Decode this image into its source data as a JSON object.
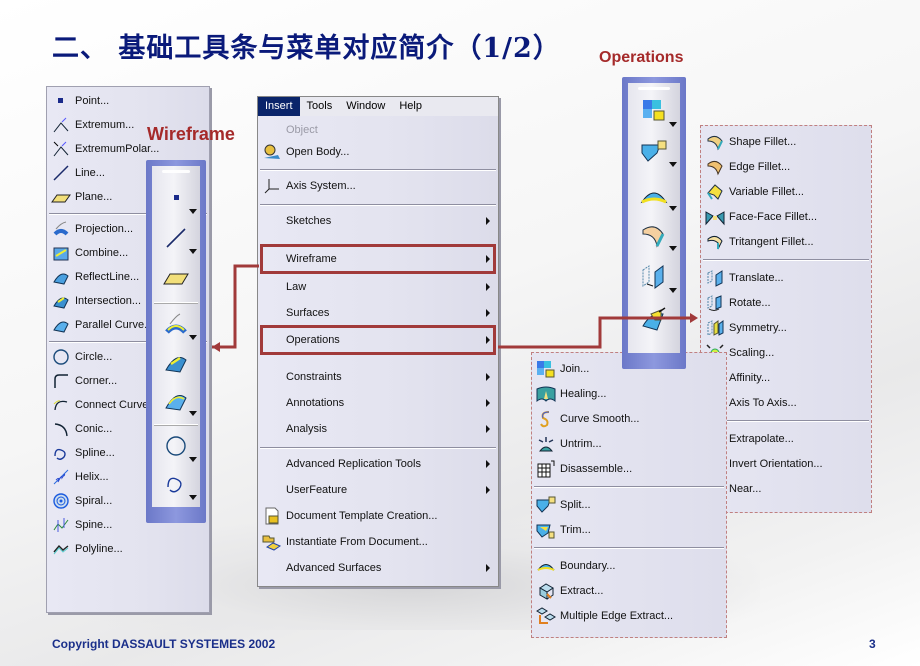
{
  "slide": {
    "title": "二、 基础工具条与菜单对应简介（1/2）",
    "copyright": "Copyright DASSAULT SYSTEMES 2002",
    "page_number": "3",
    "labels": {
      "wireframe": "Wireframe",
      "operations": "Operations"
    },
    "colors": {
      "title": "#0a1a7a",
      "label": "#a52a2a",
      "highlight": "#a13a3a",
      "menubar_active": "#0a246a",
      "toolbar": "#7a86d4"
    }
  },
  "wireframe_menu": {
    "items": [
      {
        "label": "Point...",
        "icon": "point-icon"
      },
      {
        "label": "Extremum...",
        "icon": "extremum-icon"
      },
      {
        "label": "ExtremumPolar...",
        "icon": "extremum-polar-icon"
      },
      {
        "label": "Line...",
        "icon": "line-icon"
      },
      {
        "label": "Plane...",
        "icon": "plane-icon"
      },
      {
        "label": "Projection...",
        "icon": "projection-icon"
      },
      {
        "label": "Combine...",
        "icon": "combine-icon"
      },
      {
        "label": "ReflectLine...",
        "icon": "reflect-line-icon"
      },
      {
        "label": "Intersection...",
        "icon": "intersection-icon"
      },
      {
        "label": "Parallel Curve...",
        "icon": "parallel-curve-icon"
      },
      {
        "label": "Circle...",
        "icon": "circle-icon"
      },
      {
        "label": "Corner...",
        "icon": "corner-icon"
      },
      {
        "label": "Connect Curve...",
        "icon": "connect-curve-icon"
      },
      {
        "label": "Conic...",
        "icon": "conic-icon"
      },
      {
        "label": "Spline...",
        "icon": "spline-icon"
      },
      {
        "label": "Helix...",
        "icon": "helix-icon"
      },
      {
        "label": "Spiral...",
        "icon": "spiral-icon"
      },
      {
        "label": "Spine...",
        "icon": "spine-icon"
      },
      {
        "label": "Polyline...",
        "icon": "polyline-icon"
      }
    ]
  },
  "wireframe_toolbar": {
    "buttons": [
      "point-icon",
      "line-icon",
      "plane-icon",
      "projection-icon",
      "intersection-icon",
      "parallel-curve-icon",
      "circle-icon",
      "spline-icon"
    ]
  },
  "insert_menu": {
    "menubar": [
      "Insert",
      "Tools",
      "Window",
      "Help"
    ],
    "active": "Insert",
    "items": [
      {
        "label": "Object",
        "disabled": true
      },
      {
        "label": "Open Body...",
        "icon": "open-body-icon"
      },
      {
        "label": "Axis System...",
        "icon": "axis-system-icon"
      },
      {
        "label": "Sketches",
        "submenu": true
      },
      {
        "label": "Wireframe",
        "submenu": true,
        "highlighted": true
      },
      {
        "label": "Law",
        "submenu": true
      },
      {
        "label": "Surfaces",
        "submenu": true
      },
      {
        "label": "Operations",
        "submenu": true,
        "highlighted": true
      },
      {
        "label": "Constraints",
        "submenu": true
      },
      {
        "label": "Annotations",
        "submenu": true
      },
      {
        "label": "Analysis",
        "submenu": true
      },
      {
        "label": "Advanced Replication Tools",
        "submenu": true
      },
      {
        "label": "UserFeature",
        "submenu": true
      },
      {
        "label": "Document Template Creation...",
        "icon": "document-template-icon"
      },
      {
        "label": "Instantiate From Document...",
        "icon": "instantiate-icon"
      },
      {
        "label": "Advanced Surfaces",
        "submenu": true
      }
    ]
  },
  "operations_toolbar": {
    "buttons": [
      "join-icon",
      "split-icon",
      "boundary-icon",
      "shape-fillet-icon",
      "translate-icon",
      "extrapolate-icon"
    ]
  },
  "operations_menu_right": {
    "items": [
      {
        "label": "Shape Fillet...",
        "icon": "shape-fillet-icon"
      },
      {
        "label": "Edge Fillet...",
        "icon": "edge-fillet-icon"
      },
      {
        "label": "Variable Fillet...",
        "icon": "variable-fillet-icon"
      },
      {
        "label": "Face-Face Fillet...",
        "icon": "face-face-fillet-icon"
      },
      {
        "label": "Tritangent Fillet...",
        "icon": "tritangent-fillet-icon"
      },
      {
        "label": "Translate...",
        "icon": "translate-icon"
      },
      {
        "label": "Rotate...",
        "icon": "rotate-icon"
      },
      {
        "label": "Symmetry...",
        "icon": "symmetry-icon"
      },
      {
        "label": "Scaling...",
        "icon": "scaling-icon"
      },
      {
        "label": "Affinity...",
        "icon": "affinity-icon"
      },
      {
        "label": "Axis To Axis...",
        "icon": "axis-to-axis-icon"
      },
      {
        "label": "Extrapolate...",
        "icon": "extrapolate-icon"
      },
      {
        "label": "Invert Orientation...",
        "icon": "invert-orientation-icon"
      },
      {
        "label": "Near...",
        "icon": "near-icon"
      }
    ]
  },
  "operations_menu_bottom": {
    "items": [
      {
        "label": "Join...",
        "icon": "join-icon"
      },
      {
        "label": "Healing...",
        "icon": "healing-icon"
      },
      {
        "label": "Curve Smooth...",
        "icon": "curve-smooth-icon"
      },
      {
        "label": "Untrim...",
        "icon": "untrim-icon"
      },
      {
        "label": "Disassemble...",
        "icon": "disassemble-icon"
      },
      {
        "label": "Split...",
        "icon": "split-icon"
      },
      {
        "label": "Trim...",
        "icon": "trim-icon"
      },
      {
        "label": "Boundary...",
        "icon": "boundary-icon"
      },
      {
        "label": "Extract...",
        "icon": "extract-icon"
      },
      {
        "label": "Multiple Edge Extract...",
        "icon": "multiple-edge-extract-icon"
      }
    ]
  }
}
